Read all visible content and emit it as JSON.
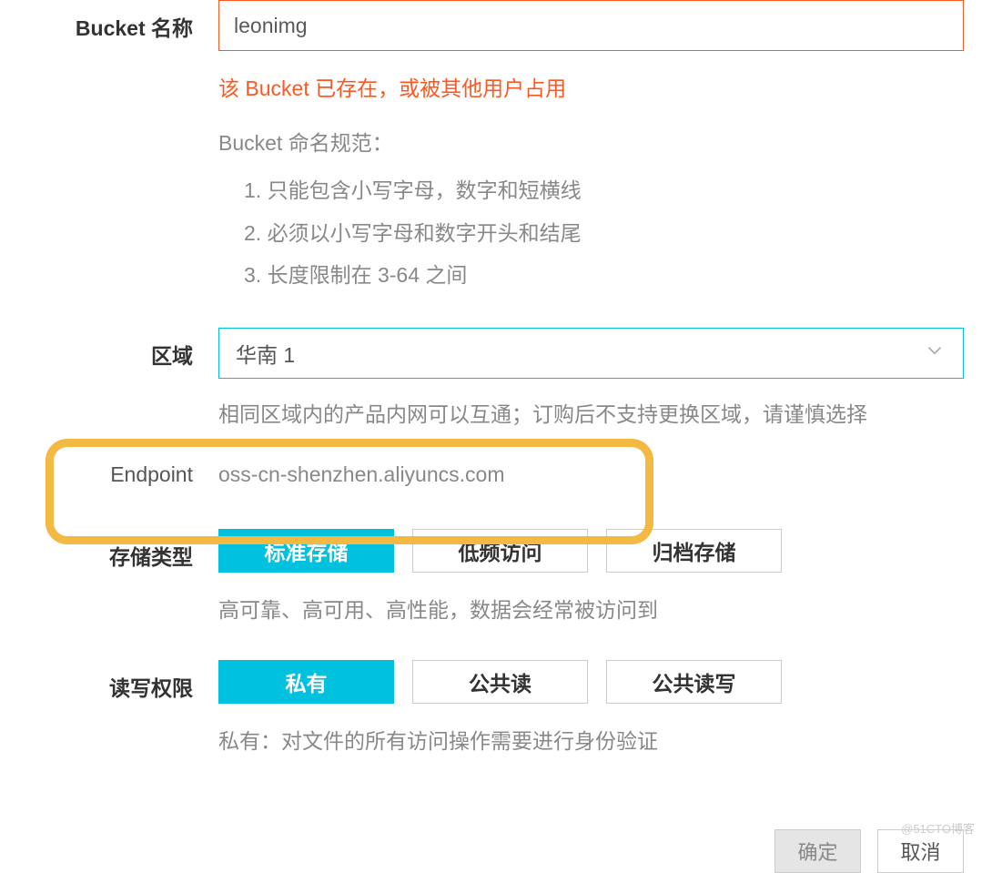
{
  "bucket": {
    "label": "Bucket 名称",
    "value": "leonimg",
    "error": "该 Bucket 已存在，或被其他用户占用",
    "rules_title": "Bucket 命名规范：",
    "rules": [
      "1. 只能包含小写字母，数字和短横线",
      "2. 必须以小写字母和数字开头和结尾",
      "3. 长度限制在 3-64 之间"
    ]
  },
  "region": {
    "label": "区域",
    "value": "华南 1",
    "hint": "相同区域内的产品内网可以互通；订购后不支持更换区域，请谨慎选择"
  },
  "endpoint": {
    "label": "Endpoint",
    "value": "oss-cn-shenzhen.aliyuncs.com"
  },
  "storage": {
    "label": "存储类型",
    "options": [
      "标准存储",
      "低频访问",
      "归档存储"
    ],
    "hint": "高可靠、高可用、高性能，数据会经常被访问到"
  },
  "acl": {
    "label": "读写权限",
    "options": [
      "私有",
      "公共读",
      "公共读写"
    ],
    "hint": "私有：对文件的所有访问操作需要进行身份验证"
  },
  "footer": {
    "confirm": "确定",
    "cancel": "取消"
  },
  "watermark": "@51CTO博客"
}
